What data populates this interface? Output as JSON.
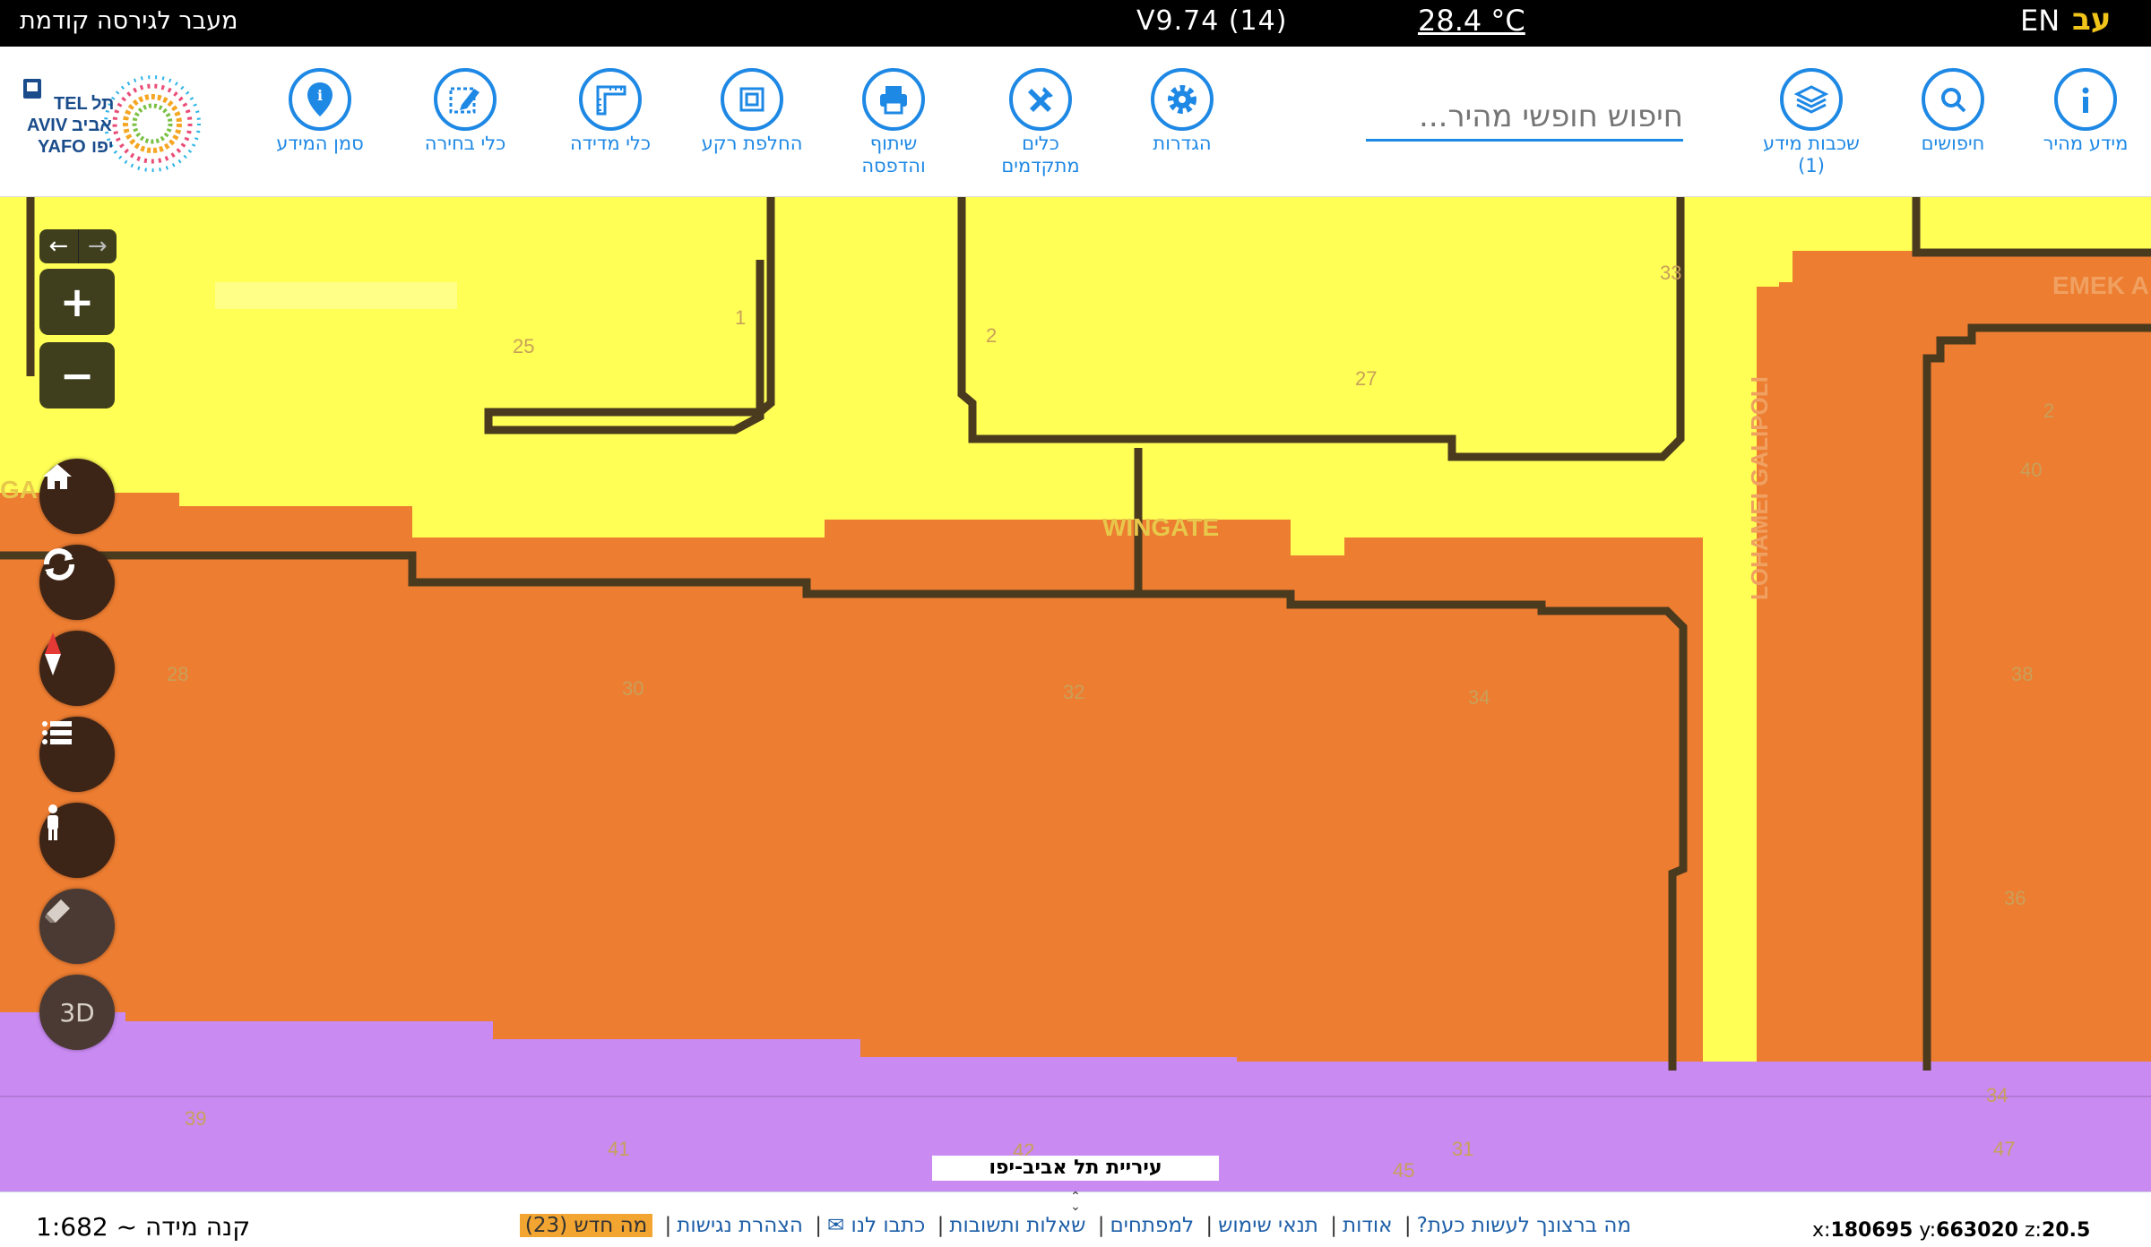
{
  "topbar": {
    "previous_version": "מעבר לגירסה קודמת",
    "version": "V9.74 (14)",
    "temperature": "28.4 °C",
    "lang_en": "EN",
    "lang_he": "עב"
  },
  "logo": {
    "text_en_1": "TEL",
    "text_en_2": "AVIV",
    "text_en_3": "YAFO",
    "text_he_1": "תל",
    "text_he_2": "אביב",
    "text_he_3": "יפו"
  },
  "toolbar": {
    "quick_info": "מידע מהיר",
    "searches": "חיפושים",
    "info_layers": "שכבות מידע",
    "info_layers_count": "(1)",
    "search_placeholder": "חיפוש חופשי מהיר...",
    "settings": "הגדרות",
    "advanced_tools_1": "כלים",
    "advanced_tools_2": "מתקדמים",
    "share_print_1": "שיתוף",
    "share_print_2": "והדפסה",
    "basemap": "החלפת רקע",
    "measure": "כלי מדידה",
    "select": "כלי בחירה",
    "mark_info": "סמן המידע"
  },
  "map": {
    "city_label": "עיריית תל אביב-יפו",
    "street_labels": [
      "WINGATE",
      "LOHAMEI GALIPOLI",
      "EMEK A",
      "GA"
    ],
    "parcel_numbers": [
      "25",
      "1",
      "2",
      "27",
      "33",
      "2",
      "40",
      "28",
      "30",
      "32",
      "34",
      "38",
      "36",
      "39",
      "41",
      "42",
      "45",
      "31",
      "34",
      "47"
    ],
    "controls": {
      "back": "←",
      "forward": "→",
      "zoom_in": "+",
      "zoom_out": "−",
      "three_d": "3D"
    }
  },
  "footer": {
    "scale": "קנה מידה ~ 1:682",
    "links": [
      "מה ברצונך לעשות כעת?",
      "אודות",
      "תנאי שימוש",
      "למפתחים",
      "שאלות ותשובות",
      "כתבו לנו ✉",
      "הצהרת נגישות"
    ],
    "news": "מה חדש (23)",
    "x_label": "x:",
    "x_value": "180695",
    "y_label": "y:",
    "y_value": "663020",
    "z_label": "z:",
    "z_value": "20.5"
  },
  "colors": {
    "accent": "#1e88e5",
    "yellow_zone": "#ffff55",
    "orange_zone": "#ed7d31",
    "purple_zone": "#c98af2",
    "control_bg": "#3c2416"
  }
}
